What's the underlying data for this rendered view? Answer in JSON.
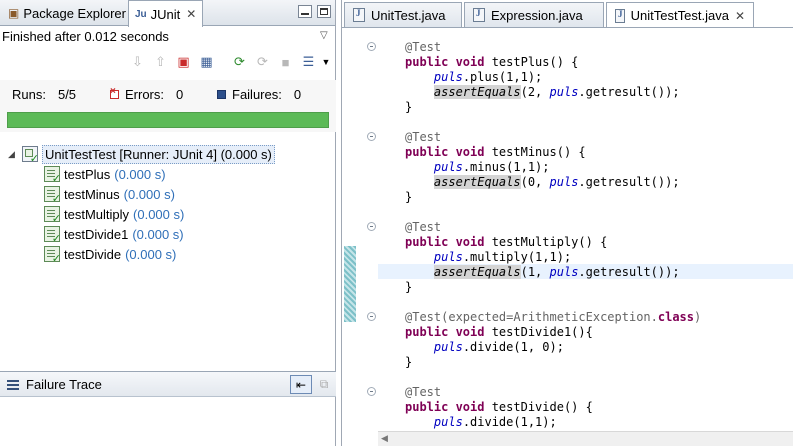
{
  "left_panel": {
    "tabs": [
      {
        "label": "Package Explorer"
      },
      {
        "label": "JUnit",
        "active": true
      }
    ],
    "status": "Finished after 0.012 seconds",
    "counters": {
      "runs_label": "Runs:",
      "runs_value": "5/5",
      "errors_label": "Errors:",
      "errors_value": "0",
      "failures_label": "Failures:",
      "failures_value": "0"
    },
    "progress": {
      "fraction": 1.0,
      "color": "#5cba57"
    },
    "tree": {
      "root": {
        "label": "UnitTestTest [Runner: JUnit 4] (0.000 s)"
      },
      "tests": [
        {
          "name": "testPlus",
          "time": "(0.000 s)"
        },
        {
          "name": "testMinus",
          "time": "(0.000 s)"
        },
        {
          "name": "testMultiply",
          "time": "(0.000 s)"
        },
        {
          "name": "testDivide1",
          "time": "(0.000 s)"
        },
        {
          "name": "testDivide",
          "time": "(0.000 s)"
        }
      ]
    },
    "failure_trace": {
      "title": "Failure Trace"
    }
  },
  "editor": {
    "tabs": [
      {
        "label": "UnitTest.java"
      },
      {
        "label": "Expression.java"
      },
      {
        "label": "UnitTestTest.java",
        "active": true
      }
    ],
    "code": {
      "test_annotation": "@Test",
      "expected_annotation": "@Test(expected=ArithmeticException.",
      "class_kw": "class",
      "close_paren": ")",
      "public_void": "public void",
      "methods": [
        {
          "signature": " testPlus() {",
          "call": "puls",
          "op": ".plus(1,1);",
          "assert": "assertEquals",
          "args_pre": "(2, ",
          "args_post": ".getresult());"
        },
        {
          "signature": " testMinus() {",
          "call": "puls",
          "op": ".minus(1,1);",
          "assert": "assertEquals",
          "args_pre": "(0, ",
          "args_post": ".getresult());"
        },
        {
          "signature": " testMultiply() {",
          "call": "puls",
          "op": ".multiply(1,1);",
          "assert": "assertEquals",
          "args_pre": "(1, ",
          "args_post": ".getresult());"
        },
        {
          "signature": " testDivide1(){",
          "call": "puls",
          "op": ".divide(1, 0);"
        },
        {
          "signature": " testDivide() {",
          "call": "puls",
          "op": ".divide(1,1);"
        }
      ],
      "brace": "}"
    }
  },
  "colors": {
    "keyword": "#7f0055",
    "field": "#0000c0",
    "annotation": "#646464",
    "time_text": "#2f6fb8"
  },
  "icons": [
    "package-explorer-icon",
    "junit-icon",
    "close-icon",
    "minimize-icon",
    "maximize-icon",
    "view-menu-icon",
    "next-failure-icon",
    "previous-failure-icon",
    "failures-only-icon",
    "scroll-lock-icon",
    "rerun-icon",
    "rerun-failed-first-icon",
    "stop-icon",
    "history-icon",
    "error-icon",
    "failure-icon",
    "suite-icon",
    "test-pass-icon",
    "failure-trace-icon",
    "filter-stack-icon",
    "compare-icon",
    "java-file-icon",
    "fold-icon"
  ]
}
